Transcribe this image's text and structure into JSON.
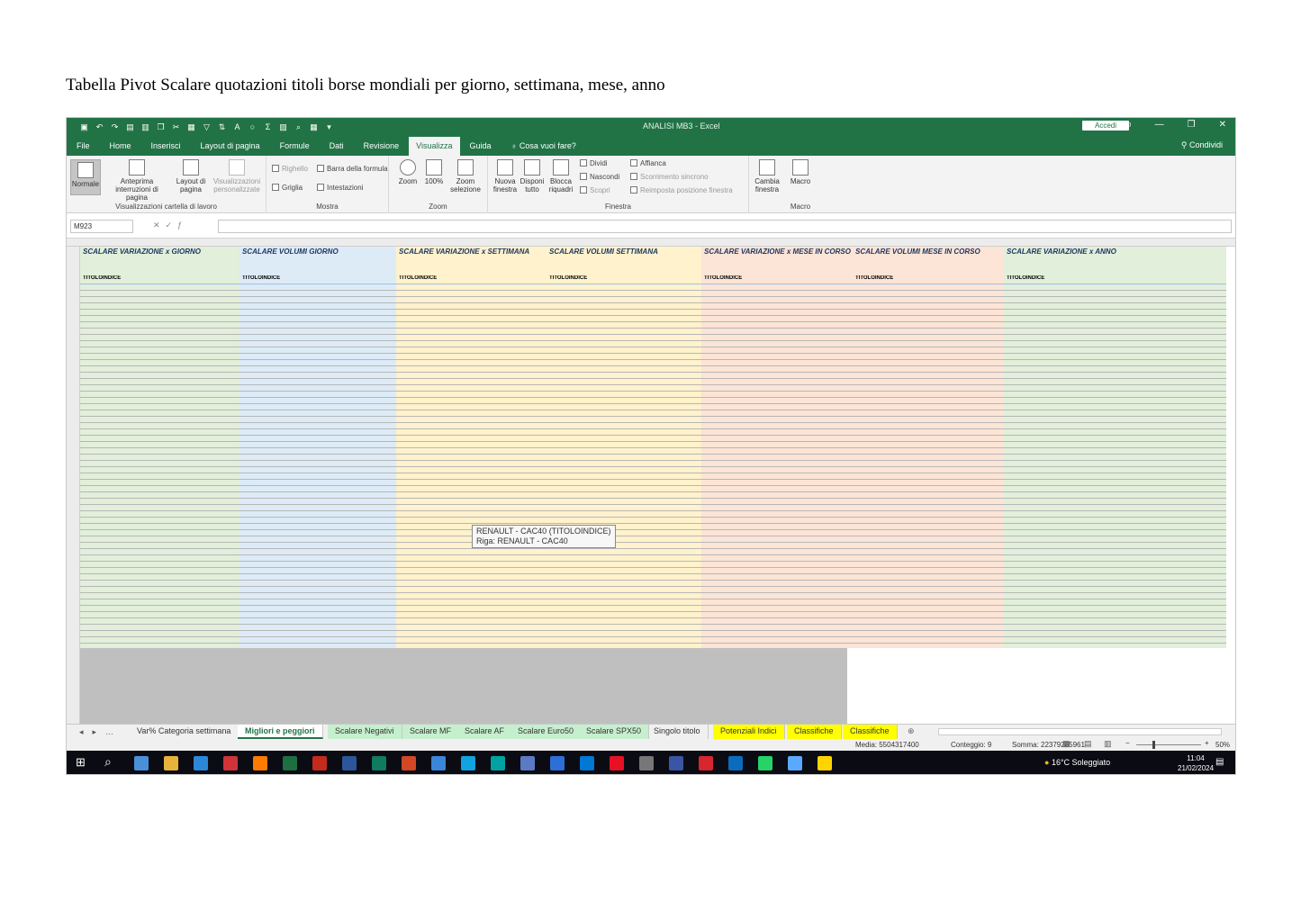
{
  "page": {
    "heading": "Tabella Pivot Scalare quotazioni titoli borse mondiali per giorno, settimana, mese, anno"
  },
  "window": {
    "doc_title": "ANALISI MB3 - Excel",
    "signin": "Accedi",
    "share": "Condividi",
    "accent": "#217346"
  },
  "menu": [
    "File",
    "Home",
    "Inserisci",
    "Layout di pagina",
    "Formule",
    "Dati",
    "Revisione",
    "Visualizza",
    "Guida",
    "Cosa vuoi fare?"
  ],
  "ribbon": {
    "normal": "Normale",
    "preview": "Anteprima interruzioni di pagina",
    "layout": "Layout di pagina",
    "custom_views": "Visualizzazioni personalizzate",
    "group_views": "Visualizzazioni cartella di lavoro",
    "ruler": "Righello",
    "formula_bar": "Barra della formula",
    "gridlines": "Griglia",
    "headings": "Intestazioni",
    "group_show": "Mostra",
    "zoom": "Zoom",
    "zoom100": "100%",
    "zoom_selection": "Zoom selezione",
    "group_zoom": "Zoom",
    "new_window": "Nuova finestra",
    "arrange_all": "Disponi tutto",
    "freeze_panes": "Blocca riquadri",
    "split": "Dividi",
    "hide": "Nascondi",
    "unhide": "Scopri",
    "side_by_side": "Affianca",
    "sync_scroll": "Scorrimento sincrono",
    "reset_position": "Reimposta posizione finestra",
    "group_window": "Finestra",
    "switch_windows": "Cambia finestra",
    "macros": "Macro",
    "group_macros": "Macro"
  },
  "formula_bar": {
    "cell_ref": "M923"
  },
  "blocks": [
    {
      "title": "SCALARE VARIAZIONE x GIORNO",
      "header": "TITOLOINDICE",
      "color": "#e2efda"
    },
    {
      "title": "SCALARE VOLUMI GIORNO",
      "header": "TITOLOINDICE",
      "color": "#ddebf7"
    },
    {
      "title": "SCALARE VARIAZIONE x SETTIMANA",
      "header": "TITOLOINDICE",
      "color": "#fff2cc"
    },
    {
      "title": "SCALARE VOLUMI SETTIMANA",
      "header": "TITOLOINDICE",
      "color": "#fff2cc"
    },
    {
      "title": "SCALARE VARIAZIONE x MESE IN CORSO",
      "header": "TITOLOINDICE",
      "color": "#fce4d6"
    },
    {
      "title": "SCALARE VOLUMI MESE IN CORSO",
      "header": "TITOLOINDICE",
      "color": "#fce4d6"
    },
    {
      "title": "SCALARE VARIAZIONE x ANNO",
      "header": "TITOLOINDICE",
      "color": "#e2efda"
    }
  ],
  "tooltip": {
    "line1": "RENAULT - CAC40 (TITOLOINDICE)",
    "line2": "Riga: RENAULT - CAC40"
  },
  "sheet_tabs": [
    "Var% Categoria settimana",
    "Migliori e peggiori",
    "Scalare Negativi",
    "Scalare MF",
    "Scalare AF",
    "Scalare Euro50",
    "Scalare SPX50",
    "Singolo titolo",
    "Potenziali Indici",
    "Classifiche",
    "Classifiche"
  ],
  "active_tab": "Migliori e peggiori",
  "status": {
    "media": "Media: 5504317400",
    "count": "Conteggio: 9",
    "sum": "Somma: 22379285961",
    "zoom": "50%"
  },
  "taskbar": {
    "weather": "16°C Soleggiato",
    "time": "11:04",
    "date": "21/02/2024"
  }
}
